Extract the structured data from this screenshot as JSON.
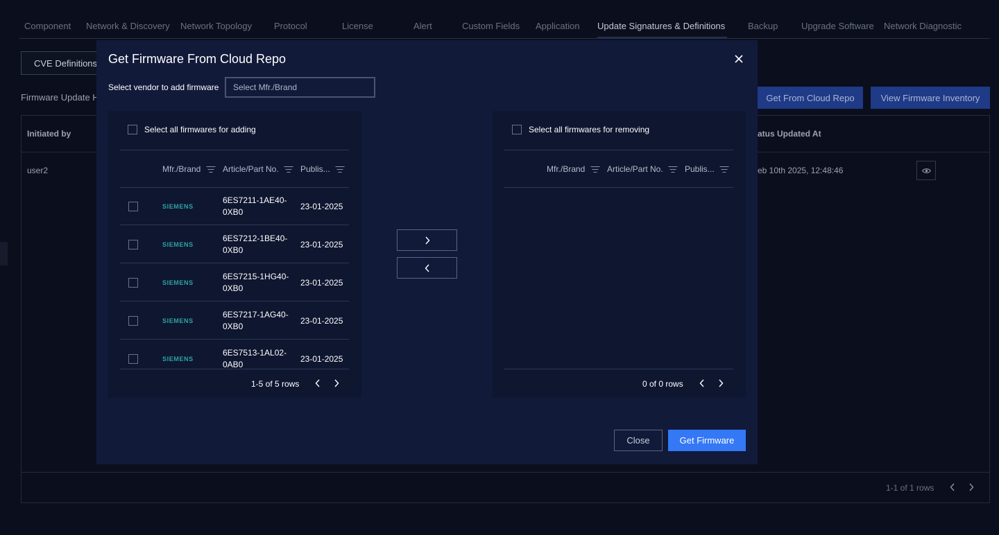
{
  "tabs": [
    "Component",
    "Network & Discovery",
    "Network Topology",
    "Protocol",
    "License",
    "Alert",
    "Custom Fields",
    "Application",
    "Update Signatures & Definitions",
    "Backup",
    "Upgrade Software",
    "Network Diagnostic"
  ],
  "background": {
    "cve_button": "CVE Definitions",
    "section_title": "Firmware Update H",
    "get_from_cloud_button": "Get From Cloud Repo",
    "view_inventory_button": "View Firmware Inventory",
    "table": {
      "col_initiated_by": "Initiated by",
      "col_status_updated": "atus Updated At",
      "row_user": "user2",
      "row_date": "eb 10th 2025, 12:48:46",
      "pager": "1-1 of 1 rows"
    }
  },
  "modal": {
    "title": "Get Firmware From Cloud Repo",
    "vendor_label": "Select vendor to add firmware",
    "vendor_placeholder": "Select Mfr./Brand",
    "left_panel": {
      "select_all": "Select all firmwares for adding",
      "columns": [
        "Mfr./Brand",
        "Article/Part No.",
        "Publis..."
      ],
      "rows": [
        {
          "brand": "SIEMENS",
          "part": "6ES7211-1AE40-0XB0",
          "published": "23-01-2025"
        },
        {
          "brand": "SIEMENS",
          "part": "6ES7212-1BE40-0XB0",
          "published": "23-01-2025"
        },
        {
          "brand": "SIEMENS",
          "part": "6ES7215-1HG40-0XB0",
          "published": "23-01-2025"
        },
        {
          "brand": "SIEMENS",
          "part": "6ES7217-1AG40-0XB0",
          "published": "23-01-2025"
        },
        {
          "brand": "SIEMENS",
          "part": "6ES7513-1AL02-0AB0",
          "published": "23-01-2025"
        }
      ],
      "pager": "1-5 of 5 rows"
    },
    "right_panel": {
      "select_all": "Select all firmwares for removing",
      "columns": [
        "Mfr./Brand",
        "Article/Part No.",
        "Publis..."
      ],
      "pager": "0 of 0 rows"
    },
    "close_button": "Close",
    "get_firmware_button": "Get Firmware"
  }
}
